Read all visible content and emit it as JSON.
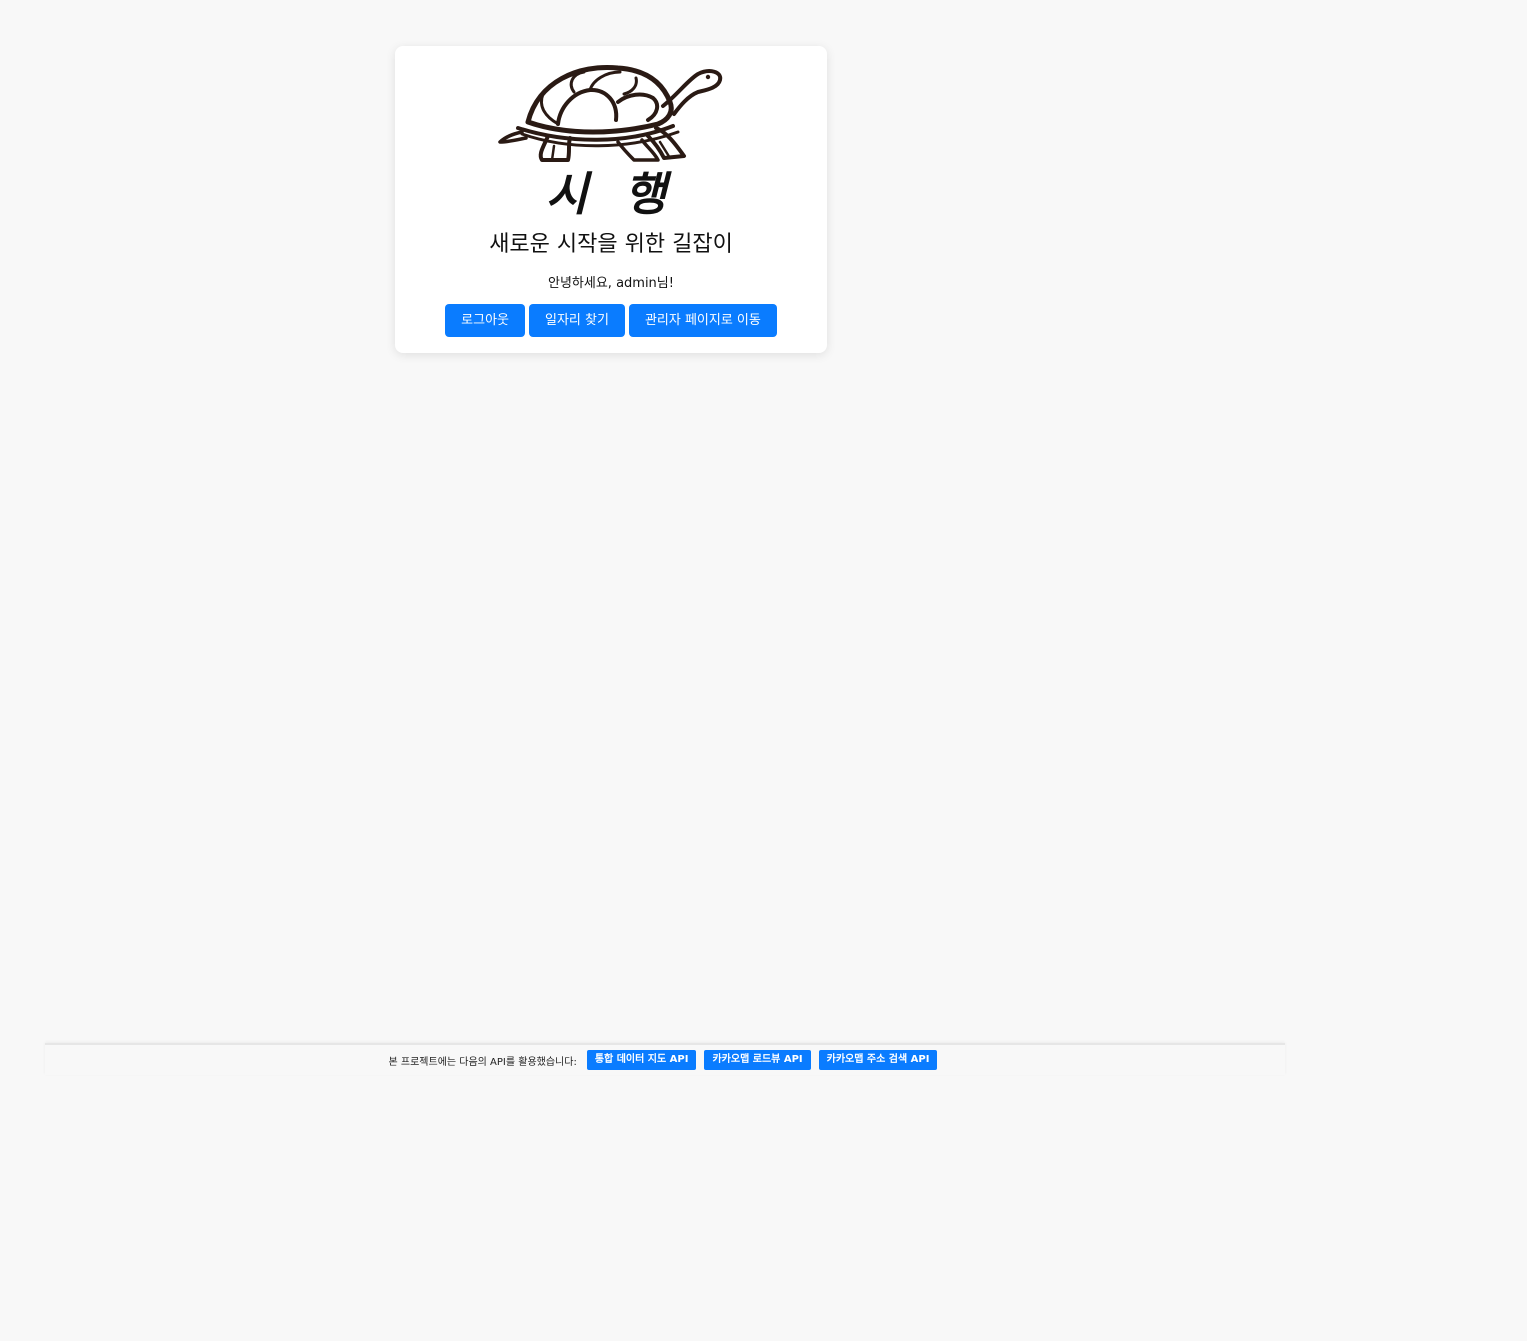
{
  "header": {
    "brand_title": "시 행",
    "tagline": "새로운 시작을 위한 길잡이",
    "greeting": "안녕하세요, admin님!",
    "logo_icon": "turtle-logo-icon"
  },
  "actions": {
    "logout_label": "로그아웃",
    "find_jobs_label": "일자리 찾기",
    "admin_page_label": "관리자 페이지로 이동"
  },
  "footer": {
    "notice": "본 프로젝트에는 다음의 API를 활용했습니다:",
    "api_links": [
      {
        "label": "통합 데이터 지도 API"
      },
      {
        "label": "카카오맵 로드뷰 API"
      },
      {
        "label": "카카오맵 주소 검색 API"
      }
    ]
  },
  "colors": {
    "page_background": "#f8f8f8",
    "card_background": "#ffffff",
    "accent": "#0a7cff",
    "text": "#111111"
  }
}
